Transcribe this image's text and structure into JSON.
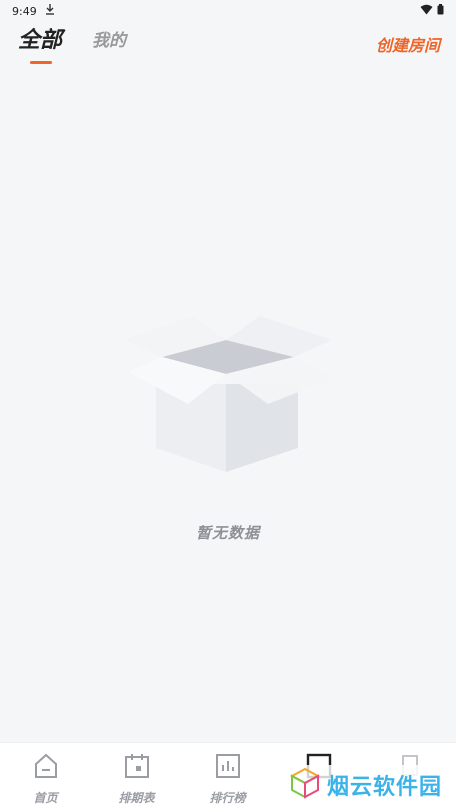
{
  "status_bar": {
    "time": "9:49",
    "icons": [
      "download-icon",
      "wifi-icon",
      "battery-icon"
    ]
  },
  "header": {
    "tabs": [
      {
        "label": "全部",
        "active": true
      },
      {
        "label": "我的",
        "active": false
      }
    ],
    "create_room_label": "创建房间"
  },
  "main": {
    "empty_text": "暂无数据",
    "empty_icon": "empty-box-icon"
  },
  "bottom_nav": {
    "items": [
      {
        "label": "首页",
        "icon": "home-icon"
      },
      {
        "label": "排期表",
        "icon": "calendar-icon"
      },
      {
        "label": "排行榜",
        "icon": "bar-chart-icon"
      },
      {
        "label": "",
        "icon": "square-icon"
      },
      {
        "label": "",
        "icon": "profile-icon"
      }
    ]
  },
  "watermark": {
    "text": "烟云软件园"
  },
  "colors": {
    "accent": "#f06428",
    "background": "#f5f6f8",
    "muted": "#9a9da4",
    "watermark": "#3ab4e8"
  }
}
